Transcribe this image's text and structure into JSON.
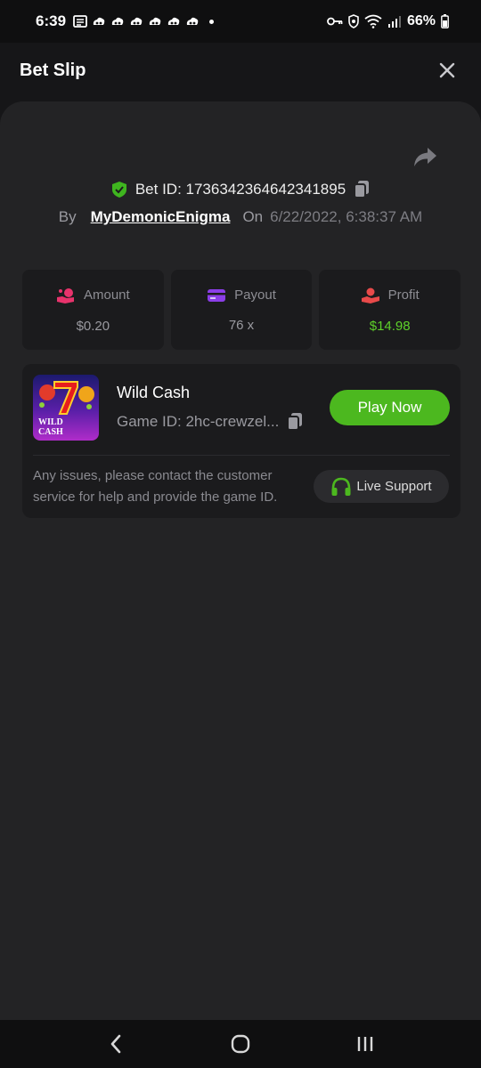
{
  "status_bar": {
    "time": "6:39",
    "battery": "66%",
    "notification_icons": [
      "news-icon",
      "cloud-icon",
      "cloud-icon",
      "cloud-icon",
      "cloud-icon",
      "cloud-icon",
      "cloud-icon"
    ]
  },
  "header": {
    "title": "Bet Slip"
  },
  "bet": {
    "id_label": "Bet ID: 1736342364642341895",
    "by_label": "By",
    "username": "MyDemonicEnigma",
    "on_label": "On",
    "date": "6/22/2022, 6:38:37 AM"
  },
  "stats": [
    {
      "label": "Amount",
      "value": "$0.20",
      "icon": "coins-hand-icon",
      "color": "#e8336c"
    },
    {
      "label": "Payout",
      "value": "76 x",
      "icon": "card-icon",
      "color": "#8b3ee8"
    },
    {
      "label": "Profit",
      "value": "$14.98",
      "icon": "profit-hand-icon",
      "color": "#e84a4a"
    }
  ],
  "game": {
    "name": "Wild Cash",
    "id_text": "Game ID: 2hc-crewzel...",
    "play_label": "Play Now",
    "thumb_title_line1": "WILD",
    "thumb_title_line2": "CASH"
  },
  "support": {
    "text": "Any issues, please contact the customer service for help and provide the game ID.",
    "button_label": "Live Support"
  },
  "colors": {
    "accent_green": "#4cb81f",
    "profit_green": "#5ed12a",
    "sheet_bg": "#232325",
    "card_bg": "#1b1b1d"
  }
}
